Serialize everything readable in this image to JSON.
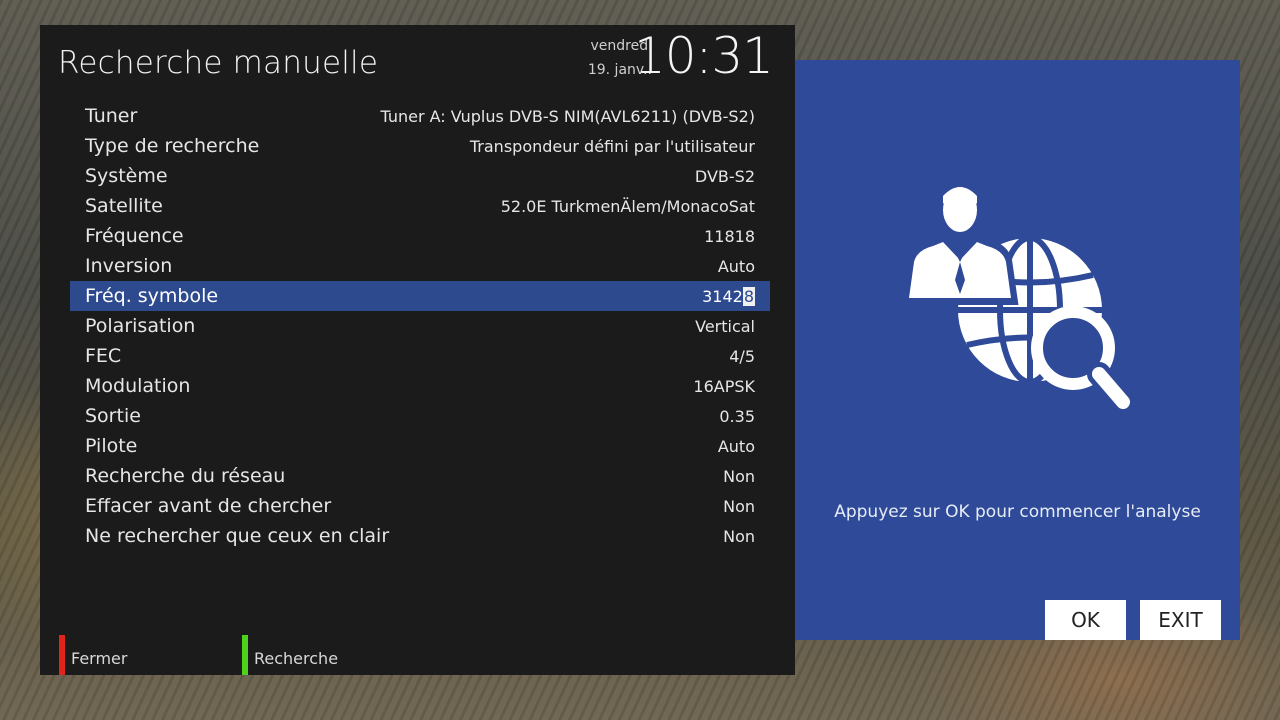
{
  "header": {
    "title": "Recherche manuelle",
    "day": "vendredi",
    "date": "19. janv..",
    "time": "10:31"
  },
  "settings": [
    {
      "label": "Tuner",
      "value": "Tuner A: Vuplus DVB-S NIM(AVL6211) (DVB-S2)"
    },
    {
      "label": "Type de recherche",
      "value": "Transpondeur défini par l'utilisateur"
    },
    {
      "label": "Système",
      "value": "DVB-S2"
    },
    {
      "label": "Satellite",
      "value": "52.0E TurkmenÄlem/MonacoSat"
    },
    {
      "label": "Fréquence",
      "value": "11818"
    },
    {
      "label": "Inversion",
      "value": "Auto"
    },
    {
      "label": "Fréq. symbole",
      "value_prefix": "3142",
      "value_cursor": "8",
      "selected": true
    },
    {
      "label": "Polarisation",
      "value": "Vertical"
    },
    {
      "label": "FEC",
      "value": "4/5"
    },
    {
      "label": "Modulation",
      "value": "16APSK"
    },
    {
      "label": "Sortie",
      "value": "0.35"
    },
    {
      "label": "Pilote",
      "value": "Auto"
    },
    {
      "label": "Recherche du réseau",
      "value": "Non"
    },
    {
      "label": "Effacer avant de chercher",
      "value": "Non"
    },
    {
      "label": "Ne rechercher que ceux en clair",
      "value": "Non"
    }
  ],
  "footer": {
    "red_label": "Fermer",
    "green_label": "Recherche",
    "red_color": "#e0231b",
    "green_color": "#4fd21c"
  },
  "side_panel": {
    "hint": "Appuyez sur OK pour commencer l'analyse",
    "ok_label": "OK",
    "exit_label": "EXIT",
    "illustration_icon": "user-globe-search-icon",
    "background_color": "#2e4a98"
  },
  "accent_color": "#2e4a8f"
}
